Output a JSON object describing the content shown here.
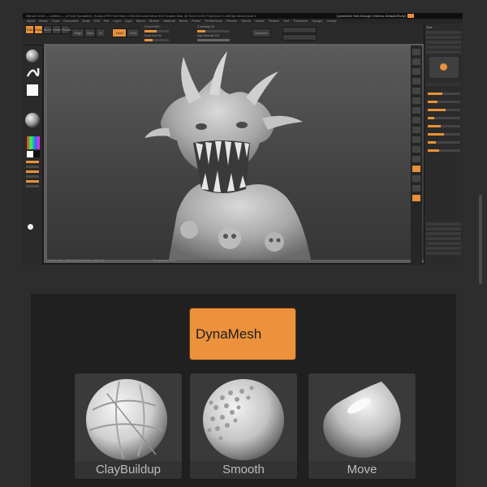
{
  "app": {
    "title_bar": "ZBrush 2018 — Untitled — (ZTool) DynaMesh_Sculpt.ZPR   Free Mem 4.932GB   Active Mem 890   Scratch Disk 48   Timer 0.001   PolyCount 1.285 Mp   MeshCount 1",
    "title_right": "QuickSave   See-through 0   Menus   DefaultZScript",
    "menu": [
      "Alpha",
      "Brush",
      "Color",
      "Document",
      "Draw",
      "Edit",
      "File",
      "Layer",
      "Light",
      "Macro",
      "Marker",
      "Material",
      "Movie",
      "Picker",
      "Preferences",
      "Render",
      "Stencil",
      "Stroke",
      "Texture",
      "Tool",
      "Transform",
      "Zplugin",
      "Zscript"
    ],
    "toolbar": {
      "edit_label": "Edit",
      "draw_label": "Draw",
      "move_label": "Move",
      "scale_label": "Scale",
      "rotate_label": "Rotate",
      "mrgb_label": "Mrgb",
      "rgb_label": "Rgb",
      "m_label": "M",
      "zadd_label": "Zadd",
      "zsub_label": "Zsub",
      "focal_label": "Focal Shift 0",
      "draw_size_label": "Draw Size 64",
      "z_intensity_label": "Z Intensity 25",
      "rgb_intensity_label": "Rgb Intensity 100",
      "dynamic_label": "Dynamic"
    },
    "status": {
      "left": "ActivePoints: 1,285 Mil   TotalPoints: 1,285 Mil",
      "center": "Perspective   Floor"
    },
    "right_panel_title": "Tool"
  },
  "big_button": {
    "label": "DynaMesh"
  },
  "brushes": [
    {
      "label": "ClayBuildup",
      "icon": "claybuildup-brush-icon"
    },
    {
      "label": "Smooth",
      "icon": "smooth-brush-icon"
    },
    {
      "label": "Move",
      "icon": "move-brush-icon"
    }
  ],
  "colors": {
    "accent": "#ec923c",
    "background": "#2d2d2d",
    "panel": "#202020"
  }
}
